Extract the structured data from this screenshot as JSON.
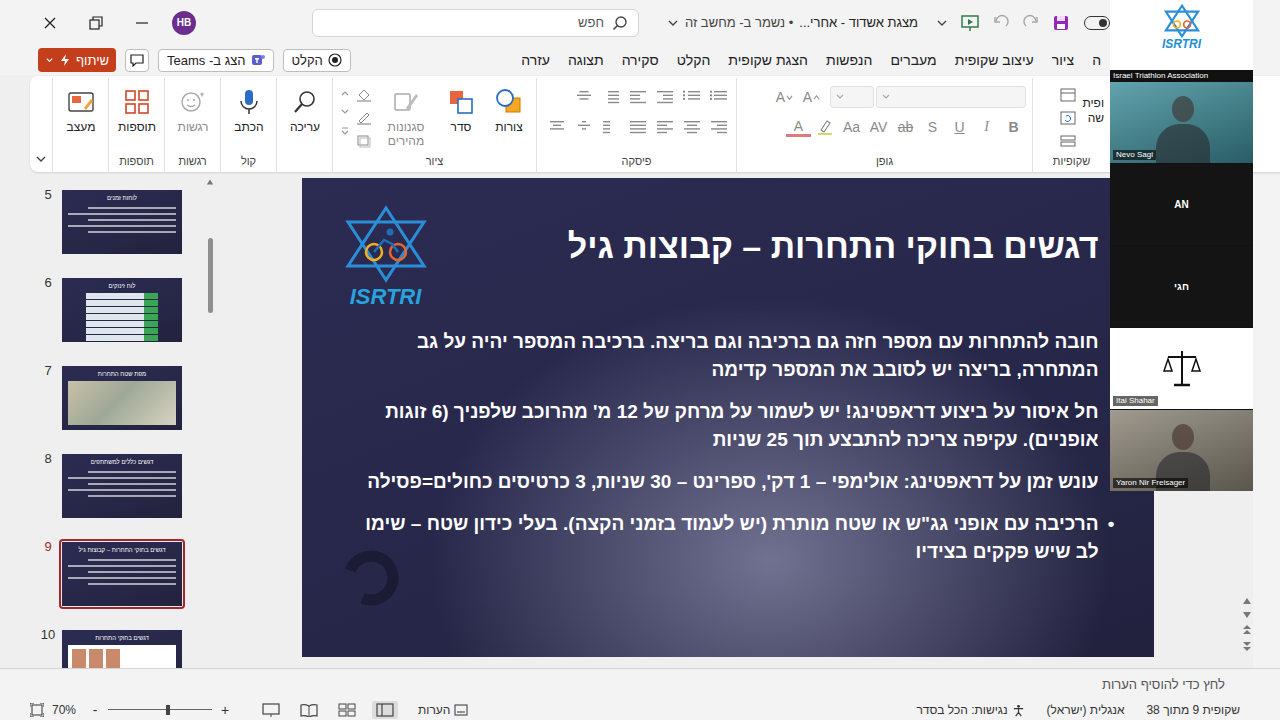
{
  "window": {
    "title": "מצגת אשדוד - אחרי...",
    "save_state": "• נשמר ב- מחשב זה",
    "avatar": "HB"
  },
  "search": {
    "placeholder": "חפש"
  },
  "tabs": [
    {
      "label": "ה",
      "selected": false
    },
    {
      "label": "ציור",
      "selected": false
    },
    {
      "label": "עיצוב שקופית",
      "selected": false
    },
    {
      "label": "מעברים",
      "selected": false
    },
    {
      "label": "הנפשות",
      "selected": false
    },
    {
      "label": "הצגת שקופית",
      "selected": false
    },
    {
      "label": "הקלט",
      "selected": false
    },
    {
      "label": "סקירה",
      "selected": false
    },
    {
      "label": "תצוגה",
      "selected": false
    },
    {
      "label": "עזרה",
      "selected": false
    }
  ],
  "actions": {
    "record": "הקלט",
    "present_in_teams": "הצג ב- Teams",
    "share": "שיתוף"
  },
  "ribbon": {
    "slides_group": {
      "label": "שקופיות",
      "button_lines": [
        "ופית",
        "שה"
      ]
    },
    "font_group": {
      "label": "גופן",
      "disabled": true,
      "size_buttons": [
        "A",
        "A"
      ],
      "format_buttons": [
        "B",
        "I",
        "U",
        "S",
        "ab",
        "AV",
        "Aa",
        "A"
      ]
    },
    "paragraph_group": {
      "label": "פיסקה",
      "disabled": true
    },
    "drawing_group": {
      "label": "ציור",
      "buttons": [
        {
          "label": "צורות",
          "disabled": false
        },
        {
          "label": "סדר",
          "disabled": false
        },
        {
          "label": "סגנונות מהירים",
          "disabled": true
        }
      ]
    },
    "groups": [
      {
        "label": "",
        "buttons": [
          {
            "label": "עריכה",
            "disabled": false
          }
        ]
      },
      {
        "label": "קול",
        "buttons": [
          {
            "label": "הכתב",
            "disabled": false
          }
        ]
      },
      {
        "label": "רגשות",
        "buttons": [
          {
            "label": "רגשות",
            "disabled": true
          }
        ]
      },
      {
        "label": "תוספות",
        "buttons": [
          {
            "label": "תוספות",
            "disabled": false
          }
        ]
      },
      {
        "label": "",
        "buttons": [
          {
            "label": "מעצב",
            "disabled": false
          }
        ]
      }
    ]
  },
  "thumbnails": [
    {
      "number": "5",
      "title": "לוחות זמנים",
      "kind": "text",
      "selected": false
    },
    {
      "number": "6",
      "title": "לוח זינוקים",
      "kind": "table",
      "selected": false
    },
    {
      "number": "7",
      "title": "מפת שטח התחרות",
      "kind": "map",
      "selected": false
    },
    {
      "number": "8",
      "title": "דגשים כללים למשתתפים",
      "kind": "text",
      "selected": false
    },
    {
      "number": "9",
      "title": "דגשים בחוקי התחרות – קבוצות גיל",
      "kind": "text",
      "selected": true
    },
    {
      "number": "10",
      "title": "דגשים בחוקי התחרות",
      "kind": "photo",
      "selected": false
    }
  ],
  "slide": {
    "logo_text": "ISRTRI",
    "title": "דגשים בחוקי התחרות – קבוצות גיל",
    "paragraphs": [
      {
        "kind": "plain",
        "text": "חובה להתחרות עם מספר חזה גם ברכיבה וגם בריצה. ברכיבה המספר יהיה על גב המתחרה, בריצה יש לסובב את המספר קדימה"
      },
      {
        "kind": "plain",
        "text": "חל איסור על ביצוע דראפטינג! יש לשמור על מרחק של 12 מ' מהרוכב שלפניך (6 זוגות אופניים). עקיפה צריכה להתבצע תוך 25 שניות"
      },
      {
        "kind": "plain",
        "text": "עונש זמן על דראפטינג: אולימפי – 1 דק', ספרינט – 30 שניות, 3 כרטיסים כחולים=פסילה"
      },
      {
        "kind": "bullet",
        "bullet": "•",
        "text": "הרכיבה עם אופני גג\"ש או שטח מותרת (יש לעמוד בזמני הקצה). בעלי כידון שטח – שימו לב שיש פקקים בצידיו"
      }
    ]
  },
  "notes": {
    "placeholder": "לחץ כדי להוסיף הערות"
  },
  "status_bar": {
    "slide_position": "שקופית 9 מתוך 38",
    "language": "אנגלית (ישראל)",
    "accessibility": "נגישות: הכל בסדר",
    "notes_button": "הערות",
    "views": [
      {
        "selected": true
      },
      {
        "selected": false
      },
      {
        "selected": false
      },
      {
        "selected": false
      }
    ],
    "zoom": {
      "plus": "+",
      "minus": "-",
      "level": 0.58,
      "reading": "70%"
    }
  },
  "video_panel": {
    "tiles": [
      {
        "kind": "logo",
        "logo_text": "ISRTRI",
        "name": "Israel Triathlon Association"
      },
      {
        "kind": "video",
        "name": "Nevo Sagi",
        "color": "#3f8f9c"
      },
      {
        "kind": "avatar",
        "name": "AN"
      },
      {
        "kind": "avatar",
        "name": "חגי"
      },
      {
        "kind": "picture",
        "name": "Itai Shahar",
        "color": "#ffffff"
      },
      {
        "kind": "video",
        "name": "Yaron Nir Freisager",
        "color": "#8b8476"
      }
    ]
  }
}
